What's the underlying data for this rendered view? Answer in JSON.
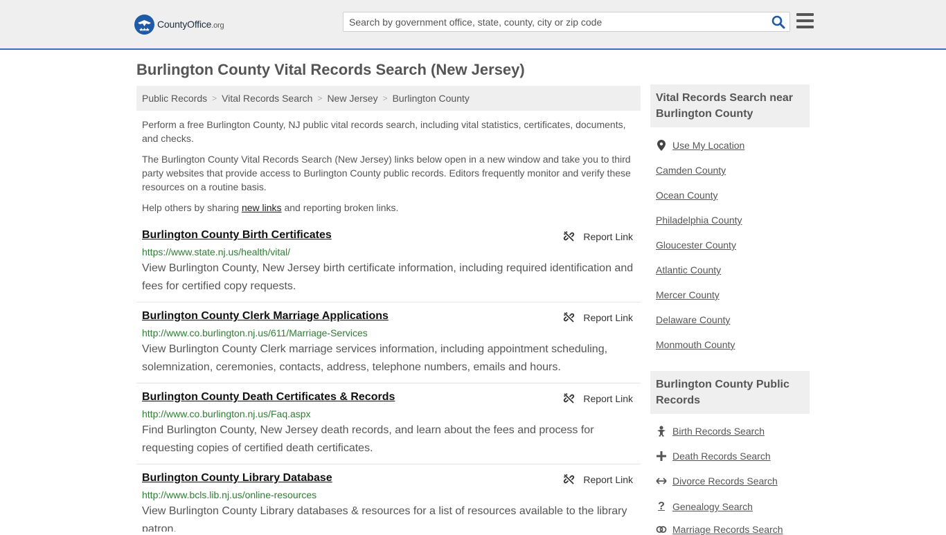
{
  "header": {
    "logo_main": "CountyOffice",
    "logo_tld": ".org",
    "search_placeholder": "Search by government office, state, county, city or zip code"
  },
  "page_title": "Burlington County Vital Records Search (New Jersey)",
  "breadcrumb": [
    "Public Records",
    "Vital Records Search",
    "New Jersey",
    "Burlington County"
  ],
  "intro": {
    "p1": "Perform a free Burlington County, NJ public vital records search, including vital statistics, certificates, documents, and checks.",
    "p2": "The Burlington County Vital Records Search (New Jersey) links below open in a new window and take you to third party websites that provide access to Burlington County public records. Editors frequently monitor and verify these resources on a routine basis.",
    "p3_before": "Help others by sharing ",
    "p3_link": "new links",
    "p3_after": " and reporting broken links."
  },
  "report_label": "Report Link",
  "results": [
    {
      "title": "Burlington County Birth Certificates",
      "url": "https://www.state.nj.us/health/vital/",
      "desc": "View Burlington County, New Jersey birth certificate information, including required identification and fees for certified copy requests."
    },
    {
      "title": "Burlington County Clerk Marriage Applications",
      "url": "http://www.co.burlington.nj.us/611/Marriage-Services",
      "desc": "View Burlington County Clerk marriage services information, including appointment scheduling, solemnization, ceremonies, contacts, address, telephone numbers, emails and hours."
    },
    {
      "title": "Burlington County Death Certificates & Records",
      "url": "http://www.co.burlington.nj.us/Faq.aspx",
      "desc": "Find Burlington County, New Jersey death records, and learn about the fees and process for requesting copies of certified death certificates."
    },
    {
      "title": "Burlington County Library Database",
      "url": "http://www.bcls.lib.nj.us/online-resources",
      "desc": "View Burlington County Library databases & resources for a list of resources available to the library patron."
    }
  ],
  "sidebar": {
    "nearby_heading": "Vital Records Search near Burlington County",
    "use_location": "Use My Location",
    "nearby": [
      "Camden County",
      "Ocean County",
      "Philadelphia County",
      "Gloucester County",
      "Atlantic County",
      "Mercer County",
      "Delaware County",
      "Monmouth County"
    ],
    "public_heading": "Burlington County Public Records",
    "public_links": [
      {
        "label": "Birth Records Search",
        "icon": "baby-icon"
      },
      {
        "label": "Death Records Search",
        "icon": "cross-icon"
      },
      {
        "label": "Divorce Records Search",
        "icon": "split-arrows-icon"
      },
      {
        "label": "Genealogy Search",
        "icon": "question-icon"
      },
      {
        "label": "Marriage Records Search",
        "icon": "rings-icon"
      }
    ]
  }
}
